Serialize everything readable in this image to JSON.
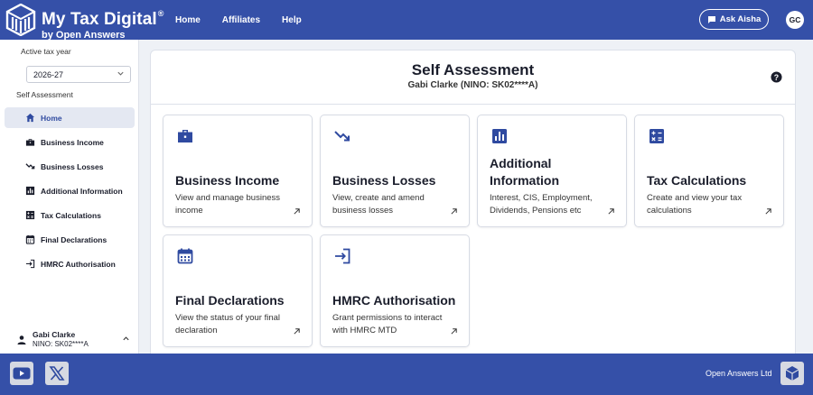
{
  "header": {
    "brand_title": "My Tax Digital",
    "brand_reg": "®",
    "brand_sub": "by Open Answers",
    "nav": [
      "Home",
      "Affiliates",
      "Help"
    ],
    "ask_label": "Ask Aisha",
    "avatar_initials": "GC"
  },
  "sidebar": {
    "tax_year_label": "Active tax year",
    "tax_year_value": "2026-27",
    "section_label": "Self Assessment",
    "items": [
      {
        "label": "Home",
        "icon": "home-icon",
        "active": true
      },
      {
        "label": "Business Income",
        "icon": "briefcase-icon",
        "active": false
      },
      {
        "label": "Business Losses",
        "icon": "trending-down-icon",
        "active": false
      },
      {
        "label": "Additional Information",
        "icon": "bar-chart-icon",
        "active": false
      },
      {
        "label": "Tax Calculations",
        "icon": "calculator-icon",
        "active": false
      },
      {
        "label": "Final Declarations",
        "icon": "calendar-icon",
        "active": false
      },
      {
        "label": "HMRC Authorisation",
        "icon": "login-icon",
        "active": false
      }
    ],
    "user": {
      "name": "Gabi Clarke",
      "nino": "NINO: SK02****A"
    }
  },
  "main": {
    "title": "Self Assessment",
    "subtitle": "Gabi Clarke (NINO: SK02****A)",
    "cards": [
      {
        "title": "Business Income",
        "desc": "View and manage business income",
        "icon": "briefcase-icon"
      },
      {
        "title": "Business Losses",
        "desc": "View, create and amend business losses",
        "icon": "trending-down-icon"
      },
      {
        "title": "Additional Information",
        "desc": "Interest, CIS, Employment, Dividends, Pensions etc",
        "icon": "bar-chart-icon"
      },
      {
        "title": "Tax Calculations",
        "desc": "Create and view your tax calculations",
        "icon": "calculator-icon"
      },
      {
        "title": "Final Declarations",
        "desc": "View the status of your final declaration",
        "icon": "calendar-icon"
      },
      {
        "title": "HMRC Authorisation",
        "desc": "Grant permissions to interact with HMRC MTD",
        "icon": "login-icon"
      }
    ]
  },
  "footer": {
    "company": "Open Answers Ltd"
  },
  "colors": {
    "brand": "#3550a8",
    "accent": "#2f4aa0",
    "active_bg": "#e4e8f2"
  }
}
